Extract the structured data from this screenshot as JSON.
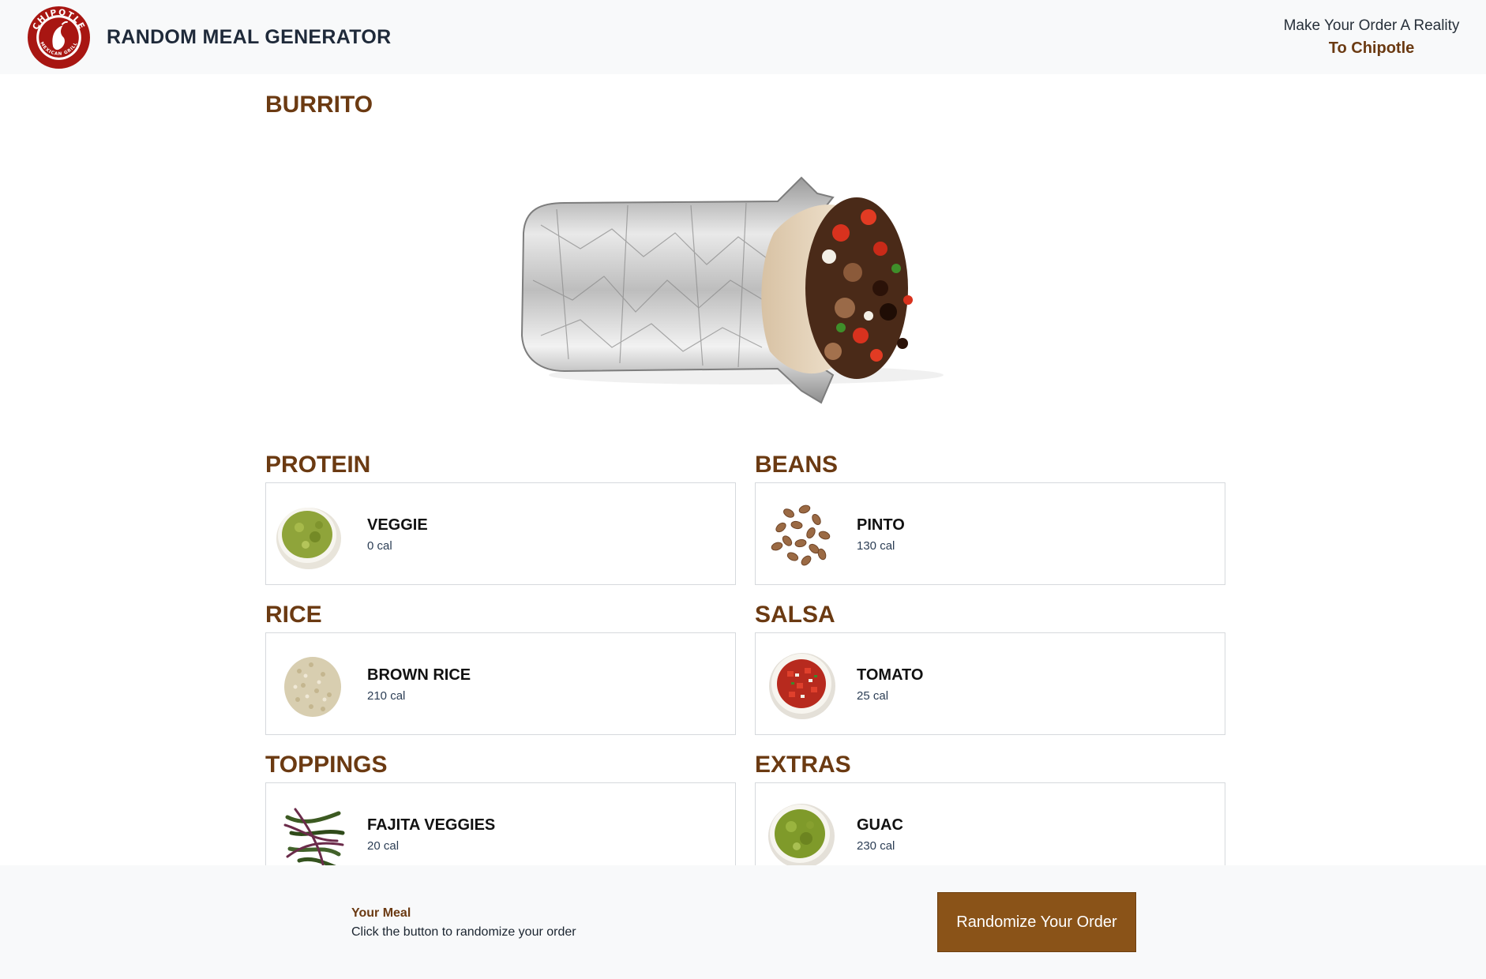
{
  "header": {
    "app_title": "RANDOM MEAL GENERATOR",
    "tagline": "Make Your Order A Reality",
    "tagline_link": "To Chipotle",
    "logo_icon": "chipotle-logo-icon",
    "logo_text": "CHIPOTLE · MEXICAN GRILL",
    "brand_color": "#a81612"
  },
  "main": {
    "entree": "BURRITO",
    "hero_image": "burrito-image",
    "sections": [
      {
        "title": "PROTEIN",
        "item": "VEGGIE",
        "cal": "0 cal",
        "icon": "guacamole-bowl-icon"
      },
      {
        "title": "BEANS",
        "item": "PINTO",
        "cal": "130 cal",
        "icon": "pinto-beans-icon"
      },
      {
        "title": "RICE",
        "item": "BROWN RICE",
        "cal": "210 cal",
        "icon": "brown-rice-icon"
      },
      {
        "title": "SALSA",
        "item": "TOMATO",
        "cal": "25 cal",
        "icon": "tomato-salsa-icon"
      },
      {
        "title": "TOPPINGS",
        "item": "FAJITA VEGGIES",
        "cal": "20 cal",
        "icon": "fajita-veggies-icon"
      },
      {
        "title": "EXTRAS",
        "item": "GUAC",
        "cal": "230 cal",
        "icon": "guac-bowl-icon"
      }
    ]
  },
  "footer": {
    "meal_label": "Your Meal",
    "meal_desc": "Click the button to randomize your order",
    "button_label": "Randomize Your Order",
    "accent": "#8a5318",
    "heading_color": "#6b3a12"
  }
}
